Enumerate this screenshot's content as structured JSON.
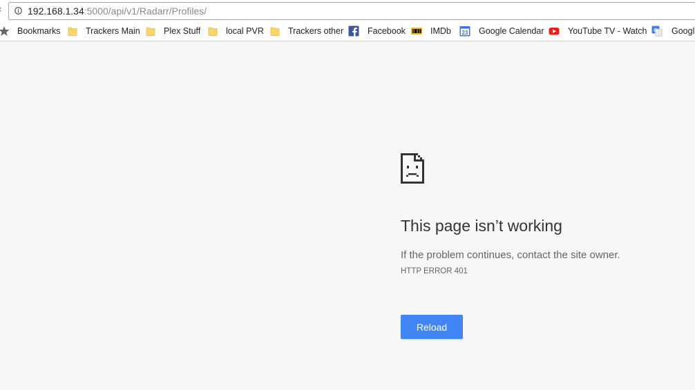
{
  "browser": {
    "url_host": "192.168.1.34",
    "url_rest": ":5000/api/v1/Radarr/Profiles/"
  },
  "bookmarks": [
    {
      "label": "Bookmarks",
      "icon": "star-icon"
    },
    {
      "label": "Trackers Main",
      "icon": "folder-icon"
    },
    {
      "label": "Plex Stuff",
      "icon": "folder-icon"
    },
    {
      "label": "local PVR",
      "icon": "folder-icon"
    },
    {
      "label": "Trackers other",
      "icon": "folder-icon"
    },
    {
      "label": "Facebook",
      "icon": "facebook-icon"
    },
    {
      "label": "IMDb",
      "icon": "imdb-icon"
    },
    {
      "label": "Google Calendar",
      "icon": "calendar-icon",
      "icon_text": "23"
    },
    {
      "label": "YouTube TV - Watch",
      "icon": "youtube-icon"
    },
    {
      "label": "Google",
      "icon": "google-translate-icon"
    }
  ],
  "error": {
    "title": "This page isn’t working",
    "message": "If the problem continues, contact the site owner.",
    "code": "HTTP ERROR 401",
    "reload_label": "Reload"
  },
  "colors": {
    "page_background": "#f7f7f7",
    "button": "#4285f4",
    "folder": "#f9d66a"
  }
}
